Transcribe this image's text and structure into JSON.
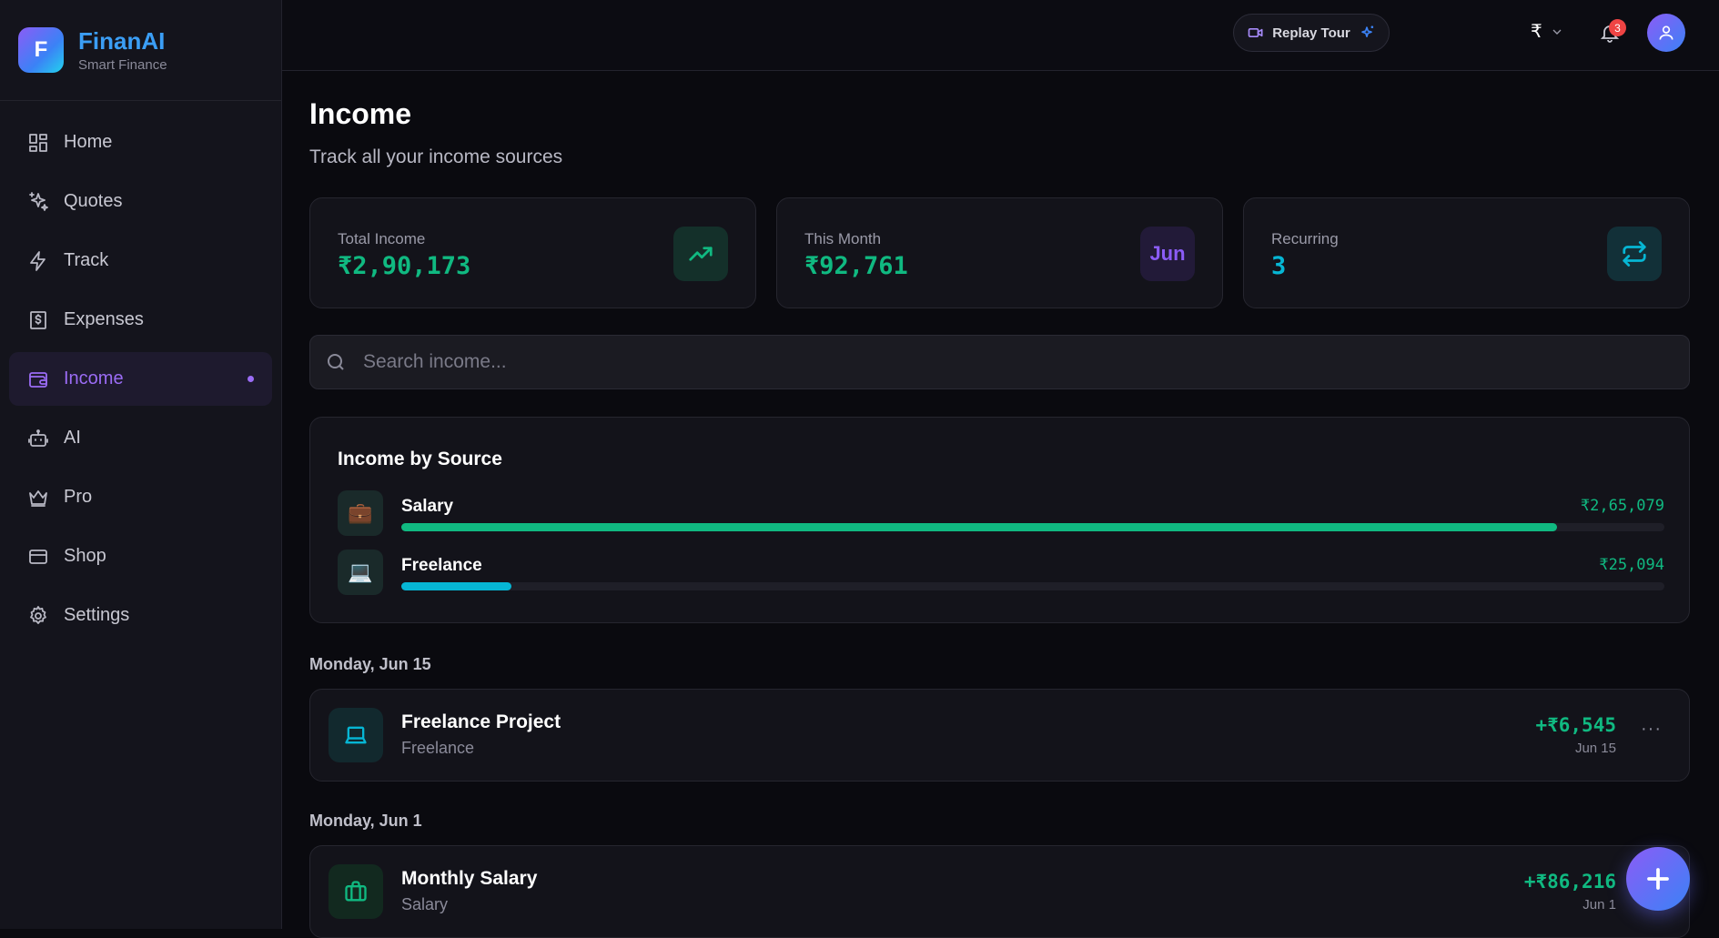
{
  "brand": {
    "logo_letter": "F",
    "name": "FinanAI",
    "tagline": "Smart Finance"
  },
  "sidebar": {
    "items": [
      {
        "label": "Home",
        "icon": "grid-icon"
      },
      {
        "label": "Quotes",
        "icon": "sparkles-icon"
      },
      {
        "label": "Track",
        "icon": "bolt-icon"
      },
      {
        "label": "Expenses",
        "icon": "receipt-icon"
      },
      {
        "label": "Income",
        "icon": "wallet-icon",
        "active": true
      },
      {
        "label": "AI",
        "icon": "robot-icon"
      },
      {
        "label": "Pro",
        "icon": "crown-icon"
      },
      {
        "label": "Shop",
        "icon": "card-icon"
      },
      {
        "label": "Settings",
        "icon": "gear-icon"
      }
    ]
  },
  "topbar": {
    "replay_label": "Replay Tour",
    "currency_symbol": "₹",
    "notification_count": "3"
  },
  "page": {
    "title": "Income",
    "subtitle": "Track all your income sources"
  },
  "stats": [
    {
      "label": "Total Income",
      "value": "₹2,90,173",
      "icon": "trending-up-icon",
      "color": "#10b981"
    },
    {
      "label": "This Month",
      "value": "₹92,761",
      "badge": "Jun",
      "color": "#10b981",
      "badge_color": "#8b5cf6"
    },
    {
      "label": "Recurring",
      "value": "3",
      "icon": "repeat-icon",
      "color": "#06b6d4"
    }
  ],
  "search": {
    "placeholder": "Search income..."
  },
  "income_by_source": {
    "title": "Income by Source",
    "sources": [
      {
        "name": "Salary",
        "emoji": "💼",
        "amount": "₹2,65,079",
        "fraction": 0.915,
        "color": "#10b981"
      },
      {
        "name": "Freelance",
        "emoji": "💻",
        "amount": "₹25,094",
        "fraction": 0.087,
        "color": "#06b6d4"
      }
    ]
  },
  "groups": [
    {
      "date": "Monday, Jun 15",
      "transactions": [
        {
          "title": "Freelance Project",
          "category": "Freelance",
          "amount": "+₹6,545",
          "date": "Jun 15",
          "icon": "laptop-icon"
        }
      ]
    },
    {
      "date": "Monday, Jun 1",
      "transactions": [
        {
          "title": "Monthly Salary",
          "category": "Salary",
          "amount": "+₹86,216",
          "date": "Jun 1",
          "icon": "briefcase-icon"
        }
      ]
    }
  ],
  "colors": {
    "accent": "#8b5cf6",
    "income_green": "#10b981",
    "cyan": "#06b6d4",
    "danger": "#ef4444"
  }
}
